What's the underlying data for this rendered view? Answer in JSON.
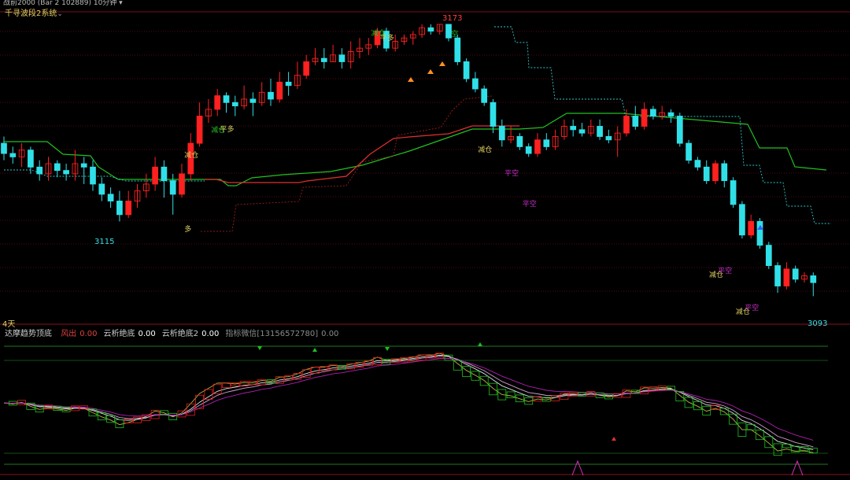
{
  "header": {
    "top_strip": "战前2000  (Bar 2 102889)  10分钟 ▾",
    "indicator_name": "千寻波段2系统",
    "indicator_chevron": "⌄"
  },
  "main_chart": {
    "price_high_label": "3173",
    "price_low_label_left": "3115",
    "price_low_label_right": "3093",
    "markers": [
      {
        "text": "减仓",
        "color": "#22c022",
        "i": 42,
        "y": 45
      },
      {
        "text": "平多",
        "color": "#e0d060",
        "i": 43,
        "y": 51
      },
      {
        "text": "空",
        "color": "#22c022",
        "i": 51,
        "y": 46
      },
      {
        "text": "减仓",
        "color": "#22c022",
        "i": 24,
        "y": 168
      },
      {
        "text": "平多",
        "color": "#e0d060",
        "i": 25,
        "y": 167
      },
      {
        "text": "减仓",
        "color": "#e0d060",
        "i": 21,
        "y": 200
      },
      {
        "text": "多",
        "color": "#e0d060",
        "i": 21,
        "y": 294
      },
      {
        "text": "减仓",
        "color": "#e0d060",
        "i": 54,
        "y": 193
      },
      {
        "text": "平空",
        "color": "#d030d0",
        "i": 57,
        "y": 223
      },
      {
        "text": "平空",
        "color": "#d030d0",
        "i": 59,
        "y": 262
      },
      {
        "text": "减仓",
        "color": "#e0d060",
        "i": 80,
        "y": 352
      },
      {
        "text": "平空",
        "color": "#d030d0",
        "i": 81,
        "y": 347
      },
      {
        "text": "减仓",
        "color": "#e0d060",
        "i": 83,
        "y": 399
      },
      {
        "text": "平空",
        "color": "#d030d0",
        "i": 84,
        "y": 394
      }
    ]
  },
  "period_label": "4天",
  "indicator_legend": {
    "name": "达摩趋势顶底",
    "items": [
      {
        "label": "风出",
        "value": "0.00",
        "label_color": "#e04040",
        "value_color": "#e04040"
      },
      {
        "label": "云析绝底",
        "value": "0.00",
        "label_color": "#cccccc",
        "value_color": "#ffffff"
      },
      {
        "label": "云析绝底2",
        "value": "0.00",
        "label_color": "#cccccc",
        "value_color": "#ffffff"
      },
      {
        "label": "指标微信[13156572780]",
        "value": "0.00",
        "label_color": "#8c8c8c",
        "value_color": "#8c8c8c"
      }
    ]
  },
  "colors": {
    "up": "#ff2020",
    "down": "#30e0e8",
    "stop_line": "#e03030",
    "green_line": "#20c020",
    "dotted_cyan": "#30c8c8",
    "grid": "#6a0a1a"
  },
  "chart_data": {
    "type": "candlestick",
    "title": "",
    "xlabel": "",
    "ylabel": "",
    "y_unit": "price",
    "ylim": [
      3088,
      3176
    ],
    "annotated_high": 3173,
    "annotated_lows": [
      3115,
      3093
    ],
    "candles": [
      [
        3138,
        3135,
        3140,
        3133
      ],
      [
        3135,
        3134,
        3137,
        3132
      ],
      [
        3134,
        3136,
        3138,
        3131
      ],
      [
        3136,
        3131,
        3137,
        3129
      ],
      [
        3131,
        3129,
        3133,
        3127
      ],
      [
        3129,
        3132,
        3134,
        3127
      ],
      [
        3132,
        3130,
        3133,
        3128
      ],
      [
        3130,
        3129,
        3132,
        3127
      ],
      [
        3129,
        3132,
        3136,
        3127
      ],
      [
        3132,
        3131,
        3134,
        3126
      ],
      [
        3131,
        3126,
        3133,
        3124
      ],
      [
        3126,
        3123,
        3128,
        3121
      ],
      [
        3123,
        3121,
        3125,
        3119
      ],
      [
        3121,
        3117,
        3124,
        3115
      ],
      [
        3117,
        3121,
        3124,
        3116
      ],
      [
        3121,
        3124,
        3126,
        3119
      ],
      [
        3124,
        3126,
        3129,
        3122
      ],
      [
        3126,
        3131,
        3134,
        3124
      ],
      [
        3131,
        3127,
        3133,
        3122
      ],
      [
        3127,
        3123,
        3129,
        3117
      ],
      [
        3123,
        3129,
        3132,
        3122
      ],
      [
        3129,
        3138,
        3141,
        3127
      ],
      [
        3138,
        3146,
        3150,
        3137
      ],
      [
        3146,
        3148,
        3151,
        3144
      ],
      [
        3148,
        3152,
        3154,
        3146
      ],
      [
        3152,
        3150,
        3153,
        3147
      ],
      [
        3150,
        3149,
        3152,
        3146
      ],
      [
        3149,
        3151,
        3155,
        3148
      ],
      [
        3151,
        3150,
        3153,
        3146
      ],
      [
        3150,
        3153,
        3156,
        3149
      ],
      [
        3153,
        3151,
        3157,
        3149
      ],
      [
        3151,
        3156,
        3159,
        3150
      ],
      [
        3156,
        3155,
        3159,
        3152
      ],
      [
        3155,
        3158,
        3162,
        3154
      ],
      [
        3158,
        3162,
        3164,
        3157
      ],
      [
        3162,
        3163,
        3166,
        3161
      ],
      [
        3163,
        3162,
        3166,
        3160
      ],
      [
        3162,
        3164,
        3167,
        3162
      ],
      [
        3164,
        3162,
        3166,
        3160
      ],
      [
        3162,
        3165,
        3168,
        3160
      ],
      [
        3165,
        3166,
        3169,
        3163
      ],
      [
        3166,
        3167,
        3169,
        3164
      ],
      [
        3167,
        3171,
        3172,
        3166
      ],
      [
        3171,
        3166,
        3172,
        3165
      ],
      [
        3166,
        3168,
        3170,
        3165
      ],
      [
        3168,
        3169,
        3170,
        3167
      ],
      [
        3169,
        3170,
        3171,
        3167
      ],
      [
        3170,
        3172,
        3173,
        3169
      ],
      [
        3172,
        3171,
        3173,
        3170
      ],
      [
        3171,
        3173,
        3173,
        3170
      ],
      [
        3173,
        3169,
        3173,
        3168
      ],
      [
        3169,
        3162,
        3170,
        3161
      ],
      [
        3162,
        3157,
        3163,
        3156
      ],
      [
        3157,
        3154,
        3159,
        3153
      ],
      [
        3154,
        3150,
        3155,
        3149
      ],
      [
        3150,
        3143,
        3151,
        3141
      ],
      [
        3143,
        3139,
        3145,
        3137
      ],
      [
        3139,
        3140,
        3143,
        3138
      ],
      [
        3140,
        3137,
        3141,
        3136
      ],
      [
        3137,
        3135,
        3138,
        3134
      ],
      [
        3135,
        3139,
        3141,
        3134
      ],
      [
        3139,
        3137,
        3141,
        3136
      ],
      [
        3137,
        3140,
        3142,
        3136
      ],
      [
        3140,
        3143,
        3145,
        3139
      ],
      [
        3143,
        3142,
        3145,
        3140
      ],
      [
        3142,
        3141,
        3144,
        3140
      ],
      [
        3141,
        3143,
        3145,
        3140
      ],
      [
        3143,
        3140,
        3145,
        3139
      ],
      [
        3140,
        3139,
        3142,
        3138
      ],
      [
        3139,
        3141,
        3143,
        3134
      ],
      [
        3141,
        3146,
        3148,
        3140
      ],
      [
        3146,
        3143,
        3149,
        3142
      ],
      [
        3143,
        3148,
        3150,
        3142
      ],
      [
        3148,
        3146,
        3149,
        3145
      ],
      [
        3146,
        3147,
        3149,
        3145
      ],
      [
        3147,
        3146,
        3148,
        3144
      ],
      [
        3146,
        3138,
        3147,
        3137
      ],
      [
        3138,
        3133,
        3139,
        3132
      ],
      [
        3133,
        3131,
        3134,
        3130
      ],
      [
        3131,
        3127,
        3133,
        3126
      ],
      [
        3127,
        3132,
        3133,
        3126
      ],
      [
        3132,
        3127,
        3133,
        3125
      ],
      [
        3127,
        3120,
        3128,
        3119
      ],
      [
        3120,
        3111,
        3121,
        3110
      ],
      [
        3111,
        3115,
        3117,
        3110
      ],
      [
        3115,
        3108,
        3116,
        3107
      ],
      [
        3108,
        3102,
        3109,
        3101
      ],
      [
        3102,
        3096,
        3103,
        3094
      ],
      [
        3096,
        3101,
        3103,
        3095
      ],
      [
        3101,
        3098,
        3102,
        3097
      ],
      [
        3098,
        3099,
        3100,
        3097
      ],
      [
        3099,
        3097,
        3100,
        3093
      ]
    ],
    "stop_line": {
      "name": "",
      "values": [
        3139,
        3141,
        3144,
        3146,
        3148,
        3150,
        3152,
        3153,
        3154,
        3155,
        3156,
        3157,
        3158
      ]
    },
    "indicator": {
      "name": "达摩趋势顶底",
      "ylim": [
        0,
        100
      ],
      "series": [
        {
          "name": "风出",
          "values": [
            0,
            0,
            0,
            0,
            0,
            0,
            0,
            0,
            0,
            0,
            0,
            0,
            0,
            0,
            0,
            0,
            0,
            0,
            0,
            0,
            0,
            0,
            0,
            0,
            0,
            0,
            0,
            0,
            0,
            0,
            0,
            0,
            0,
            0,
            0,
            0,
            0,
            0,
            0,
            0,
            0,
            0,
            0,
            0,
            0,
            0,
            0,
            0,
            0,
            0,
            0,
            0,
            0,
            0,
            0,
            0,
            0,
            0,
            0,
            0,
            0,
            0,
            0,
            0,
            0,
            0,
            0,
            0,
            0,
            0,
            0,
            0,
            0,
            0,
            0,
            0,
            0,
            0,
            0,
            0,
            0,
            0,
            0,
            0,
            0,
            0,
            0,
            0,
            0,
            0,
            0,
            0,
            0
          ]
        },
        {
          "name": "云析绝底",
          "values": [
            0,
            0,
            0,
            0,
            0,
            0,
            0,
            0,
            0,
            0,
            0,
            0,
            0,
            0,
            0,
            0,
            0,
            0,
            0,
            0,
            0,
            0,
            0,
            0,
            0,
            0,
            0,
            0,
            0,
            0,
            0,
            0,
            0,
            0,
            0,
            0,
            0,
            0,
            0,
            0,
            0,
            0,
            0,
            0,
            0,
            0,
            0,
            0,
            0,
            0,
            0,
            0,
            0,
            0,
            0,
            0,
            0,
            0,
            0,
            0,
            0,
            0,
            0,
            0,
            0,
            0,
            0,
            0,
            0,
            0,
            0,
            0,
            0,
            0,
            0,
            0,
            0,
            0,
            0,
            0,
            0,
            0,
            0,
            0,
            0,
            0,
            0,
            0,
            0,
            0,
            0,
            0,
            0
          ]
        },
        {
          "name": "云析绝底2",
          "values": [
            0,
            0,
            0,
            0,
            0,
            0,
            0,
            0,
            0,
            0,
            0,
            0,
            0,
            0,
            0,
            0,
            0,
            0,
            0,
            0,
            0,
            0,
            0,
            0,
            0,
            0,
            0,
            0,
            0,
            0,
            0,
            0,
            0,
            0,
            0,
            0,
            0,
            0,
            0,
            0,
            0,
            0,
            0,
            0,
            0,
            0,
            0,
            0,
            0,
            0,
            0,
            0,
            0,
            0,
            0,
            0,
            0,
            0,
            0,
            0,
            0,
            0,
            0,
            0,
            0,
            0,
            0,
            0,
            0,
            0,
            0,
            0,
            0,
            0,
            0,
            0,
            0,
            0,
            0,
            0,
            0,
            0,
            0,
            0,
            0,
            0,
            0,
            0,
            0,
            0,
            0,
            0,
            0
          ]
        }
      ]
    }
  }
}
